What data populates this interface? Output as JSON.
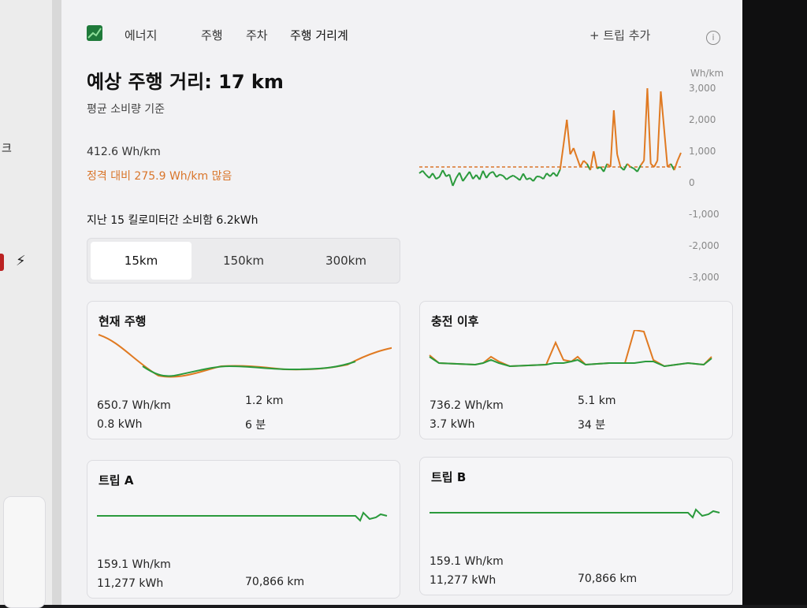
{
  "left_strip": {
    "fragment": "크",
    "bolt": "⚡"
  },
  "header": {
    "title": "에너지",
    "tabs": [
      "주행",
      "주차",
      "주행 거리계"
    ],
    "add_trip": "+ 트립 추가",
    "info": "i"
  },
  "summary": {
    "range_title": "예상 주행 거리: 17 km",
    "range_sub": "평균 소비량 기준",
    "avg": "412.6 Wh/km",
    "over": "정격 대비 275.9 Wh/km 많음",
    "last_used": "지난 15 킬로미터간 소비함 6.2kWh"
  },
  "segment": {
    "options": [
      "15km",
      "150km",
      "300km"
    ],
    "selected": "15km"
  },
  "colors": {
    "green": "#2a9a3c",
    "orange": "#e07a22",
    "bg": "#f2f2f4"
  },
  "chart_data": {
    "type": "line",
    "ylabel": "Wh/km",
    "ylim": [
      -3000,
      3000
    ],
    "ticks": [
      "3,000",
      "2,000",
      "1,000",
      "0",
      "-1,000",
      "-2,000",
      "-3,000"
    ],
    "reference": 500,
    "values": [
      300,
      380,
      250,
      150,
      300,
      120,
      180,
      400,
      200,
      260,
      -100,
      150,
      320,
      50,
      200,
      350,
      120,
      250,
      100,
      380,
      150,
      300,
      350,
      180,
      260,
      220,
      100,
      180,
      230,
      160,
      80,
      290,
      100,
      150,
      50,
      200,
      190,
      120,
      300,
      200,
      320,
      200,
      420,
      1200,
      2000,
      900,
      1100,
      800,
      500,
      700,
      600,
      400,
      1000,
      450,
      500,
      350,
      600,
      500,
      2300,
      900,
      500,
      400,
      600,
      500,
      450,
      350,
      550,
      700,
      3000,
      600,
      500,
      700,
      2900,
      1700,
      500,
      600,
      400,
      700,
      950
    ]
  },
  "cards": {
    "current": {
      "title": "현재 주행",
      "wh": "650.7 Wh/km",
      "kwh": "0.8 kWh",
      "dist": "1.2 km",
      "time": "6 분"
    },
    "charge": {
      "title": "충전 이후",
      "wh": "736.2 Wh/km",
      "kwh": "3.7 kWh",
      "dist": "5.1 km",
      "time": "34 분"
    },
    "trip_a": {
      "title": "트립 A",
      "wh": "159.1 Wh/km",
      "kwh": "11,277 kWh",
      "dist": "70,866 km"
    },
    "trip_b": {
      "title": "트립 B",
      "wh": "159.1 Wh/km",
      "kwh": "11,277 kWh",
      "dist": "70,866 km"
    }
  }
}
